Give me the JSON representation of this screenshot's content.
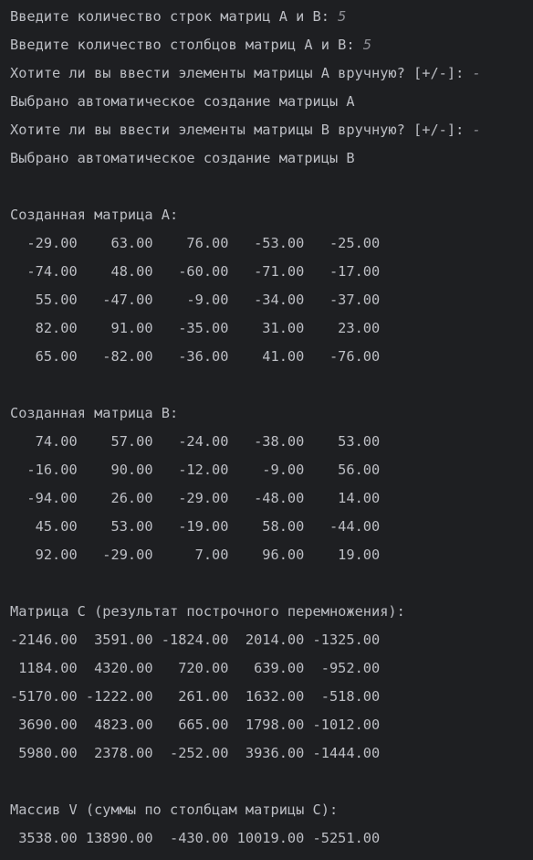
{
  "console": {
    "prompts": [
      {
        "text": "Введите количество строк матриц A и B: ",
        "input": "5"
      },
      {
        "text": "Введите количество столбцов матриц A и B: ",
        "input": "5"
      },
      {
        "text": "Хотите ли вы ввести элементы матрицы A вручную? [+/-]: ",
        "input": "-"
      }
    ],
    "auto_a": "Выбрано автоматическое создание матрицы A",
    "prompt_b": {
      "text": "Хотите ли вы ввести элементы матрицы B вручную? [+/-]: ",
      "input": "-"
    },
    "auto_b": "Выбрано автоматическое создание матрицы B",
    "matrix_a": {
      "title": "Созданная матрица A:",
      "rows": [
        "  -29.00    63.00    76.00   -53.00   -25.00",
        "  -74.00    48.00   -60.00   -71.00   -17.00",
        "   55.00   -47.00    -9.00   -34.00   -37.00",
        "   82.00    91.00   -35.00    31.00    23.00",
        "   65.00   -82.00   -36.00    41.00   -76.00"
      ]
    },
    "matrix_b": {
      "title": "Созданная матрица B:",
      "rows": [
        "   74.00    57.00   -24.00   -38.00    53.00",
        "  -16.00    90.00   -12.00    -9.00    56.00",
        "  -94.00    26.00   -29.00   -48.00    14.00",
        "   45.00    53.00   -19.00    58.00   -44.00",
        "   92.00   -29.00     7.00    96.00    19.00"
      ]
    },
    "matrix_c": {
      "title": "Матрица C (результат построчного перемножения):",
      "rows": [
        "-2146.00  3591.00 -1824.00  2014.00 -1325.00",
        " 1184.00  4320.00   720.00   639.00  -952.00",
        "-5170.00 -1222.00   261.00  1632.00  -518.00",
        " 3690.00  4823.00   665.00  1798.00 -1012.00",
        " 5980.00  2378.00  -252.00  3936.00 -1444.00"
      ]
    },
    "array_v": {
      "title": "Массив V (суммы по столбцам матрицы C):",
      "row": " 3538.00 13890.00  -430.00 10019.00 -5251.00"
    }
  }
}
